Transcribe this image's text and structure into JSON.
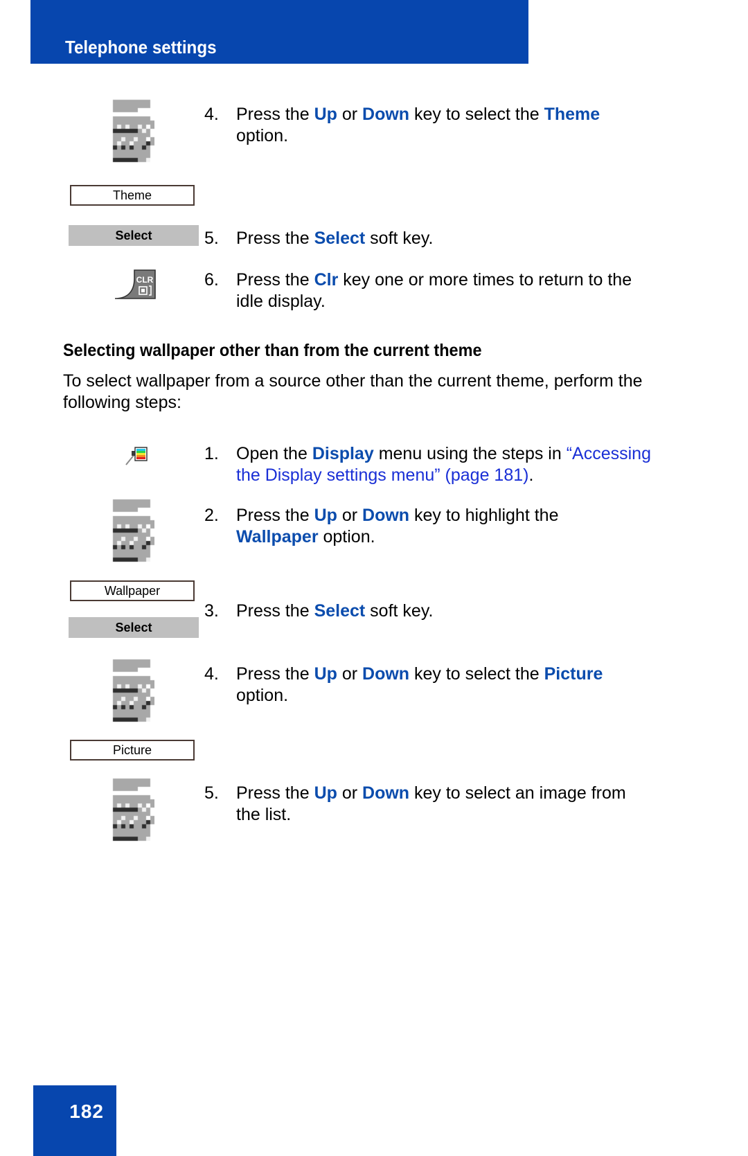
{
  "header": {
    "title": "Telephone settings"
  },
  "section_one": {
    "steps": [
      {
        "number": "4.",
        "icon": "lcd-screen-icon",
        "parts": [
          {
            "t": "Press the ",
            "style": "plain"
          },
          {
            "t": "Up",
            "style": "key"
          },
          {
            "t": " or ",
            "style": "plain"
          },
          {
            "t": "Down",
            "style": "key"
          },
          {
            "t": " key to select the ",
            "style": "plain"
          },
          {
            "t": "Theme",
            "style": "key"
          },
          {
            "t": " option.",
            "style": "plain"
          }
        ],
        "option_label": "Theme"
      },
      {
        "number": "5.",
        "icon": "softkey-icon",
        "parts": [
          {
            "t": "Press the ",
            "style": "plain"
          },
          {
            "t": "Select",
            "style": "key"
          },
          {
            "t": " soft key.",
            "style": "plain"
          }
        ],
        "softkey_label": "Select"
      },
      {
        "number": "6.",
        "icon": "clr-key-icon",
        "parts": [
          {
            "t": "Press the ",
            "style": "plain"
          },
          {
            "t": "Clr",
            "style": "key"
          },
          {
            "t": " key one or more times to return to the idle display.",
            "style": "plain"
          }
        ],
        "clr_key_label": "CLR"
      }
    ]
  },
  "section_two": {
    "heading": "Selecting wallpaper other than from the current theme",
    "intro": "To select wallpaper from a source other than the current theme, perform the following steps:",
    "steps": [
      {
        "number": "1.",
        "icon": "display-settings-icon",
        "parts": [
          {
            "t": "Open the ",
            "style": "plain"
          },
          {
            "t": "Display",
            "style": "key"
          },
          {
            "t": " menu using the steps in ",
            "style": "plain"
          },
          {
            "t": "“Accessing the Display settings menu” (page 181)",
            "style": "link"
          },
          {
            "t": ".",
            "style": "plain"
          }
        ]
      },
      {
        "number": "2.",
        "icon": "lcd-screen-icon",
        "parts": [
          {
            "t": "Press the ",
            "style": "plain"
          },
          {
            "t": "Up",
            "style": "key"
          },
          {
            "t": " or ",
            "style": "plain"
          },
          {
            "t": "Down",
            "style": "key"
          },
          {
            "t": " key to highlight the ",
            "style": "plain"
          },
          {
            "t": "Wallpaper",
            "style": "key"
          },
          {
            "t": " option.",
            "style": "plain"
          }
        ],
        "option_label": "Wallpaper"
      },
      {
        "number": "3.",
        "icon": "softkey-icon",
        "parts": [
          {
            "t": "Press the ",
            "style": "plain"
          },
          {
            "t": "Select",
            "style": "key"
          },
          {
            "t": " soft key.",
            "style": "plain"
          }
        ],
        "softkey_label": "Select"
      },
      {
        "number": "4.",
        "icon": "lcd-screen-icon",
        "parts": [
          {
            "t": "Press the ",
            "style": "plain"
          },
          {
            "t": "Up",
            "style": "key"
          },
          {
            "t": " or ",
            "style": "plain"
          },
          {
            "t": "Down",
            "style": "key"
          },
          {
            "t": " key to select the ",
            "style": "plain"
          },
          {
            "t": "Picture",
            "style": "key"
          },
          {
            "t": " option.",
            "style": "plain"
          }
        ],
        "option_label": "Picture"
      },
      {
        "number": "5.",
        "icon": "lcd-screen-icon",
        "parts": [
          {
            "t": "Press the ",
            "style": "plain"
          },
          {
            "t": "Up",
            "style": "key"
          },
          {
            "t": " or ",
            "style": "plain"
          },
          {
            "t": "Down",
            "style": "key"
          },
          {
            "t": " key to select an image from the list.",
            "style": "plain"
          }
        ]
      }
    ]
  },
  "footer": {
    "page_number": "182"
  },
  "colors": {
    "brand_blue": "#0746AE",
    "key_blue": "#0B4CAD",
    "link_blue": "#1A2FD6",
    "softkey_gray": "#BFBFBF",
    "box_border": "#4A3A34"
  }
}
